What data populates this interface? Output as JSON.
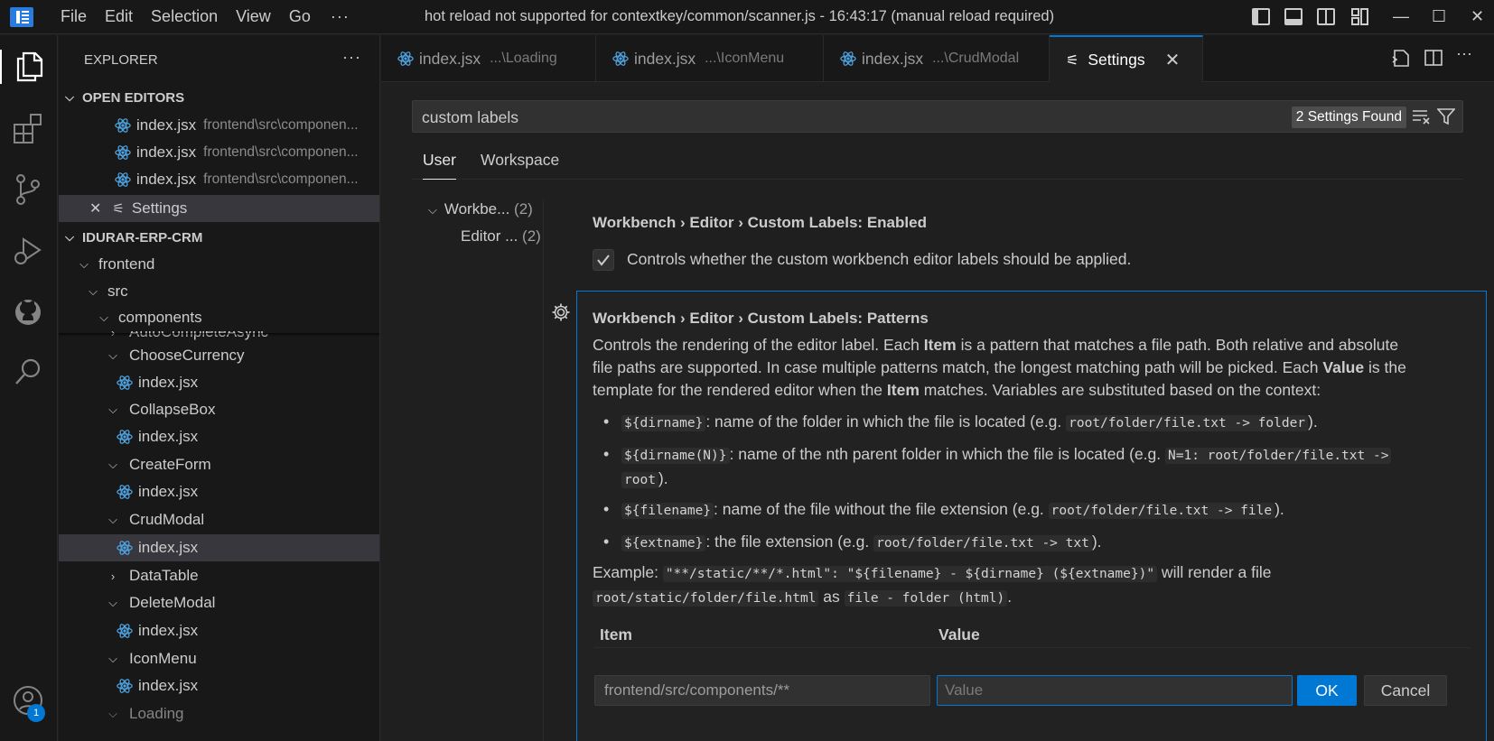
{
  "titlebar": {
    "menu": [
      "File",
      "Edit",
      "Selection",
      "View",
      "Go"
    ],
    "more": "···",
    "title": "hot reload not supported for contextkey/common/scanner.js - 16:43:17 (manual reload required)"
  },
  "activity": {
    "accounts_badge": "1"
  },
  "explorer": {
    "title": "EXPLORER",
    "more": "···",
    "open_editors_header": "OPEN EDITORS",
    "open_editors": [
      {
        "name": "index.jsx",
        "path": "frontend\\src\\componen..."
      },
      {
        "name": "index.jsx",
        "path": "frontend\\src\\componen..."
      },
      {
        "name": "index.jsx",
        "path": "frontend\\src\\componen..."
      }
    ],
    "settings_editor": "Settings",
    "project_header": "IDURAR-ERP-CRM",
    "tree": {
      "frontend": "frontend",
      "src": "src",
      "components": "components",
      "autocomplete": "AutoCompleteAsync",
      "choose_currency": "ChooseCurrency",
      "collapse_box": "CollapseBox",
      "create_form": "CreateForm",
      "crud_modal": "CrudModal",
      "data_table": "DataTable",
      "delete_modal": "DeleteModal",
      "icon_menu": "IconMenu",
      "loading": "Loading",
      "index_file": "index.jsx"
    }
  },
  "tabs": [
    {
      "name": "index.jsx",
      "desc": "...\\Loading"
    },
    {
      "name": "index.jsx",
      "desc": "...\\IconMenu"
    },
    {
      "name": "index.jsx",
      "desc": "...\\CrudModal"
    },
    {
      "name": "Settings",
      "desc": ""
    }
  ],
  "settings": {
    "search_value": "custom labels",
    "found": "2 Settings Found",
    "scope_user": "User",
    "scope_workspace": "Workspace",
    "toc_workbench": "Workbe...",
    "toc_workbench_count": "(2)",
    "toc_editor": "Editor ...",
    "toc_editor_count": "(2)",
    "enabled": {
      "category": "Workbench › Editor › Custom Labels: ",
      "name": "Enabled",
      "checked": true,
      "description": "Controls whether the custom workbench editor labels should be applied."
    },
    "patterns": {
      "category": "Workbench › Editor › Custom Labels: ",
      "name": "Patterns",
      "desc_1a": "Controls the rendering of the editor label. Each ",
      "desc_item": "Item",
      "desc_1b": " is a pattern that matches a file path. Both relative and absolute",
      "desc_2a": "file paths are supported. In case multiple patterns match, the longest matching path will be picked. Each ",
      "desc_value": "Value",
      "desc_2b": " is the",
      "desc_3a": "template for the rendered editor when the ",
      "desc_3b": " matches. Variables are substituted based on the context:",
      "b1_code": "${dirname}",
      "b1_text": ": name of the folder in which the file is located (e.g. ",
      "b1_ex": "root/folder/file.txt -> folder",
      "b1_end": ").",
      "b2_code": "${dirname(N)}",
      "b2_text": ": name of the nth parent folder in which the file is located (e.g. ",
      "b2_ex": "N=1: root/folder/file.txt ->",
      "b2_ex2": "root",
      "b2_end": ").",
      "b3_code": "${filename}",
      "b3_text": ": name of the file without the file extension (e.g. ",
      "b3_ex": "root/folder/file.txt -> file",
      "b3_end": ").",
      "b4_code": "${extname}",
      "b4_text": ": the file extension (e.g. ",
      "b4_ex": "root/folder/file.txt -> txt",
      "b4_end": ").",
      "example_label": "Example: ",
      "example_code": "\"**/static/**/*.html\": \"${filename} - ${dirname} (${extname})\"",
      "example_text": " will render a file",
      "example_path": "root/static/folder/file.html",
      "example_as": " as ",
      "example_result": "file - folder (html)",
      "example_end": ".",
      "col_item": "Item",
      "col_value": "Value",
      "item_value": "frontend/src/components/**",
      "value_placeholder": "Value",
      "ok": "OK",
      "cancel": "Cancel"
    }
  },
  "colors": {
    "accent": "#0078d4",
    "background": "#1f1f1f",
    "sidebar": "#181818"
  }
}
